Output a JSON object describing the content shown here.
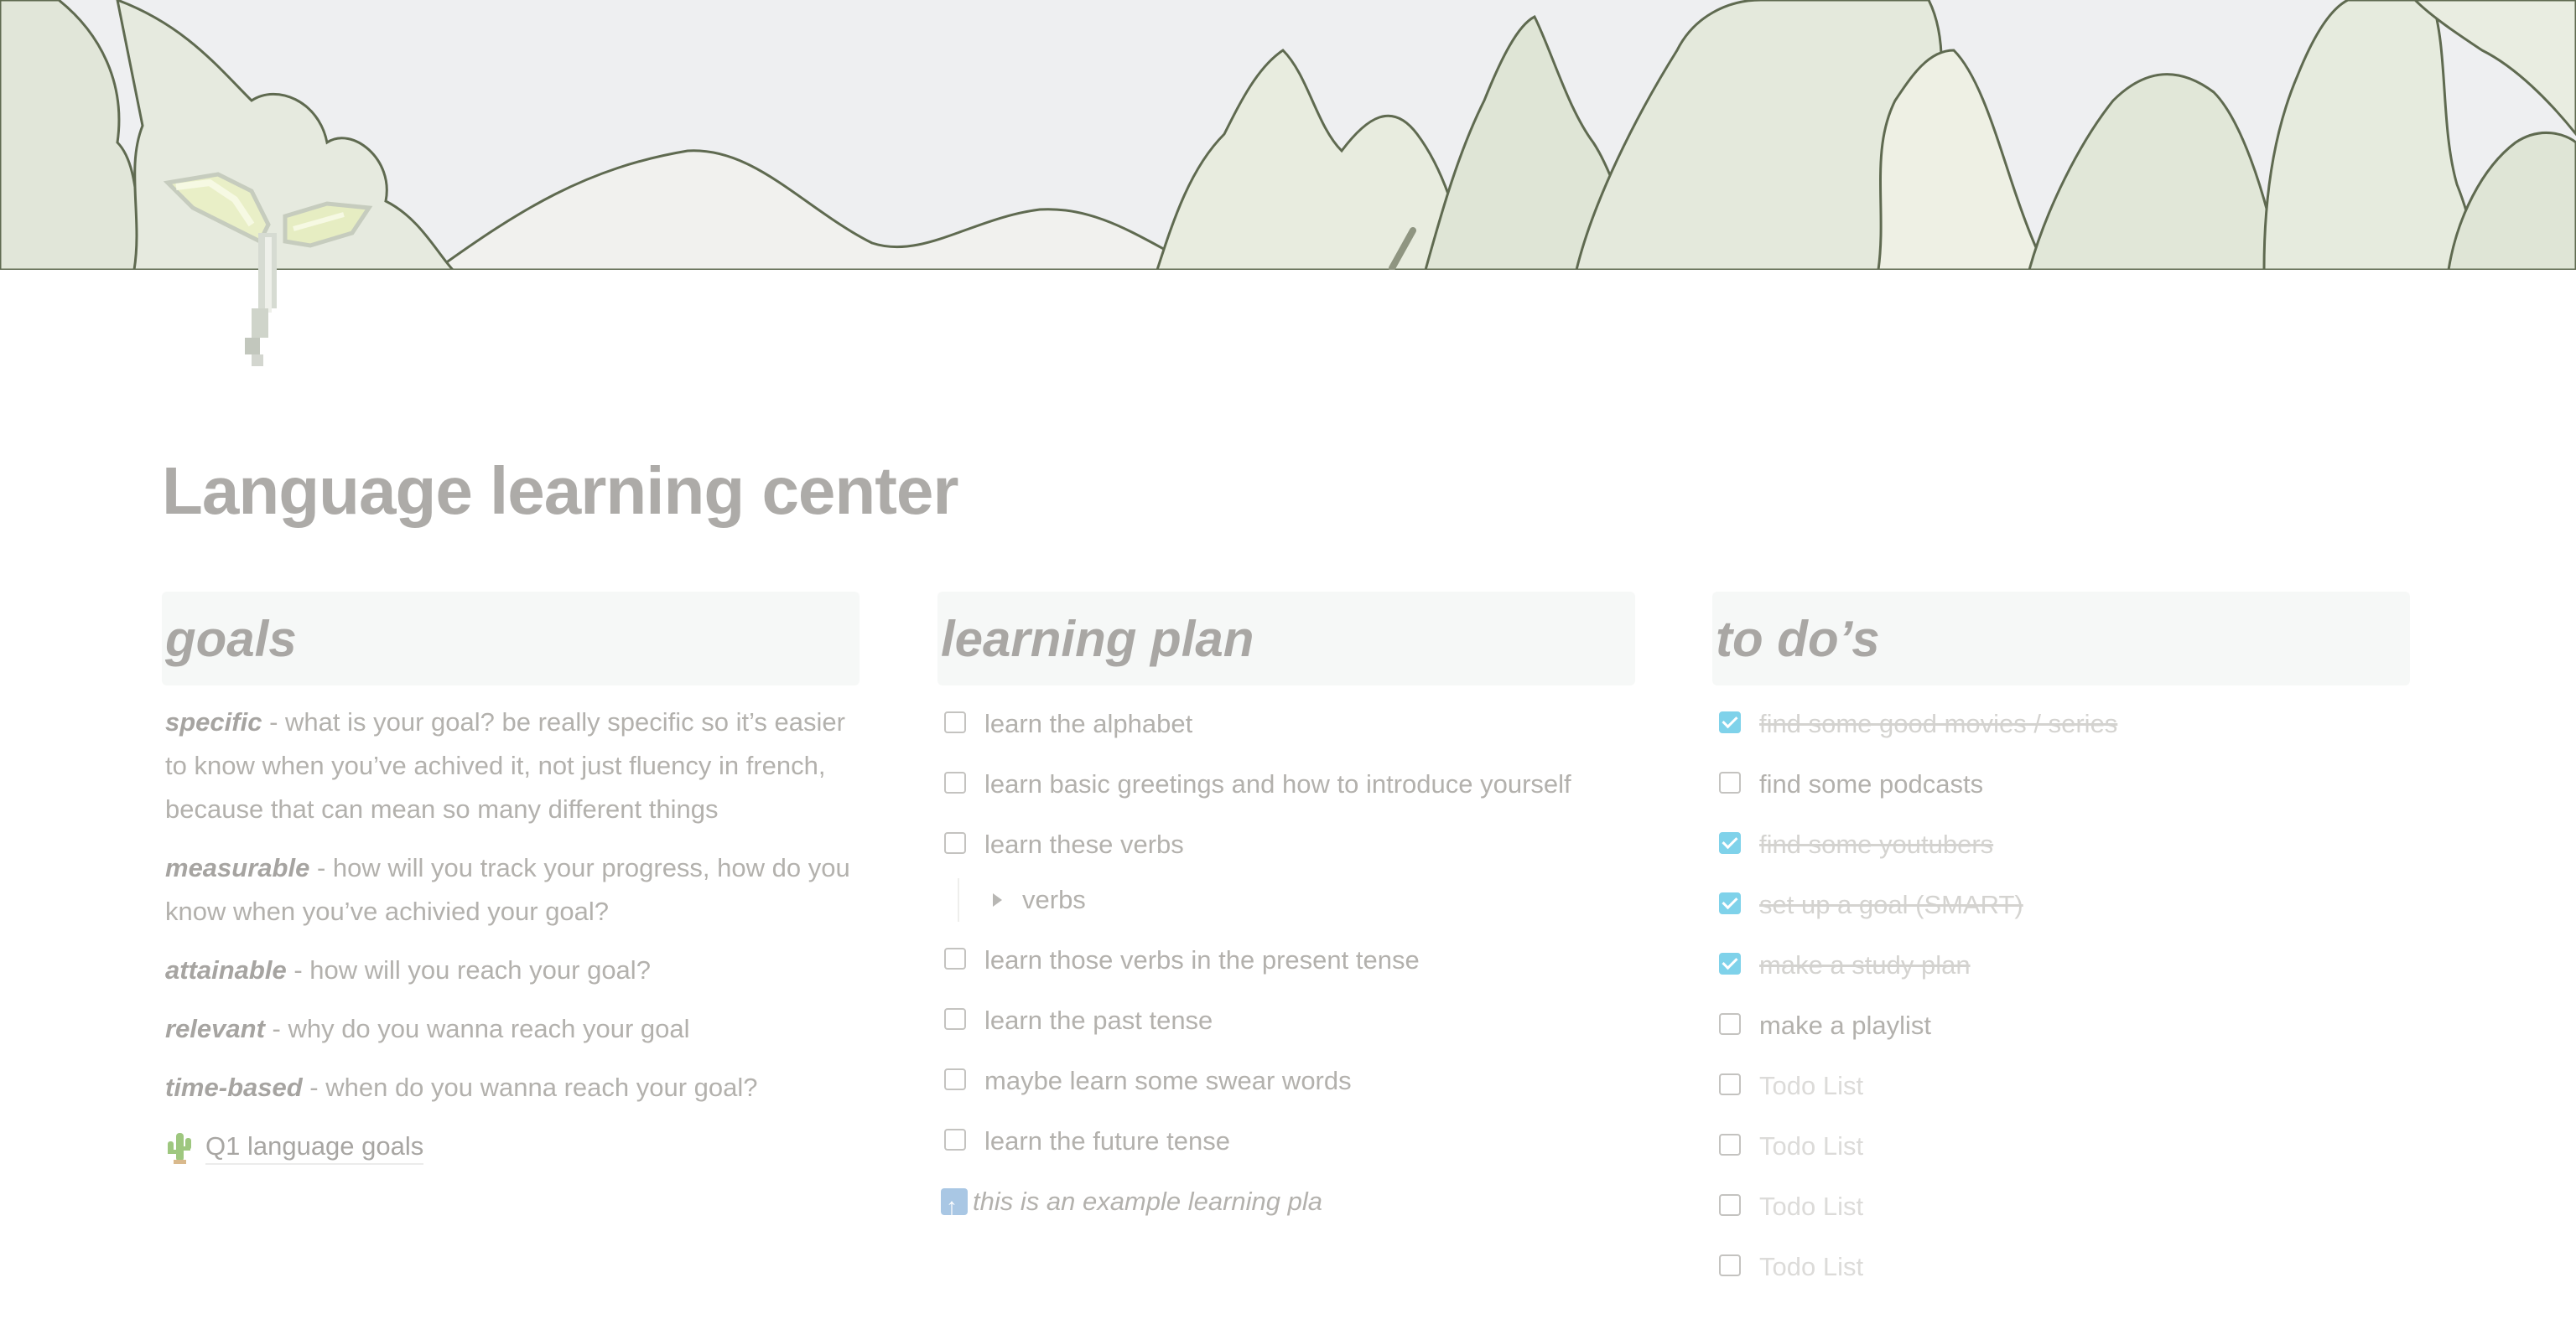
{
  "page": {
    "title": "Language learning center"
  },
  "cover": {
    "palette": {
      "sky": "#eeeff1",
      "tree_light": "#eef0e4",
      "tree_mid": "#dfe6d6",
      "outline": "#5f6a50"
    }
  },
  "icons": {
    "page_icon": "sprout-icon",
    "goal_link_icon": "cactus-icon",
    "note_icon": "up-arrow-icon",
    "toggle_icon": "triangle-right-icon"
  },
  "accent": {
    "checkbox_checked": "#7fd2ea"
  },
  "columns": {
    "goals": {
      "heading": "goals",
      "items": [
        {
          "term": "specific",
          "text": " - what is your goal? be really specific so it’s easier to know when you’ve achived it, not just fluency in french, because that can mean so many different things"
        },
        {
          "term": "measurable",
          "text": " - how will you track your progress, how do you know when you’ve achivied your goal?"
        },
        {
          "term": "attainable",
          "text": " - how will you reach your goal?"
        },
        {
          "term": "relevant",
          "text": " - why do you wanna reach your goal"
        },
        {
          "term": "time-based",
          "text": " - when do you wanna reach your goal?"
        }
      ],
      "link": "Q1 language goals"
    },
    "plan": {
      "heading": "learning plan",
      "items": [
        {
          "label": "learn the alphabet",
          "checked": false
        },
        {
          "label": "learn basic greetings and how to introduce yourself",
          "checked": false
        },
        {
          "label": "learn these verbs",
          "checked": false
        }
      ],
      "toggle": "verbs",
      "items2": [
        {
          "label": "learn those verbs in the present tense",
          "checked": false
        },
        {
          "label": "learn the past tense",
          "checked": false
        },
        {
          "label": "maybe learn some swear words",
          "checked": false
        },
        {
          "label": "learn the future tense",
          "checked": false
        }
      ],
      "note": "this is an example learning pla"
    },
    "todos": {
      "heading": "to do’s",
      "items": [
        {
          "label": "find some good movies / series",
          "checked": true
        },
        {
          "label": "find some podcasts",
          "checked": false
        },
        {
          "label": "find some youtubers",
          "checked": true
        },
        {
          "label": "set up a goal (SMART)",
          "checked": true
        },
        {
          "label": "make a study plan",
          "checked": true
        },
        {
          "label": "make a playlist",
          "checked": false
        },
        {
          "label": "Todo List",
          "checked": false,
          "placeholder": true
        },
        {
          "label": "Todo List",
          "checked": false,
          "placeholder": true
        },
        {
          "label": "Todo List",
          "checked": false,
          "placeholder": true
        },
        {
          "label": "Todo List",
          "checked": false,
          "placeholder": true
        }
      ]
    }
  }
}
